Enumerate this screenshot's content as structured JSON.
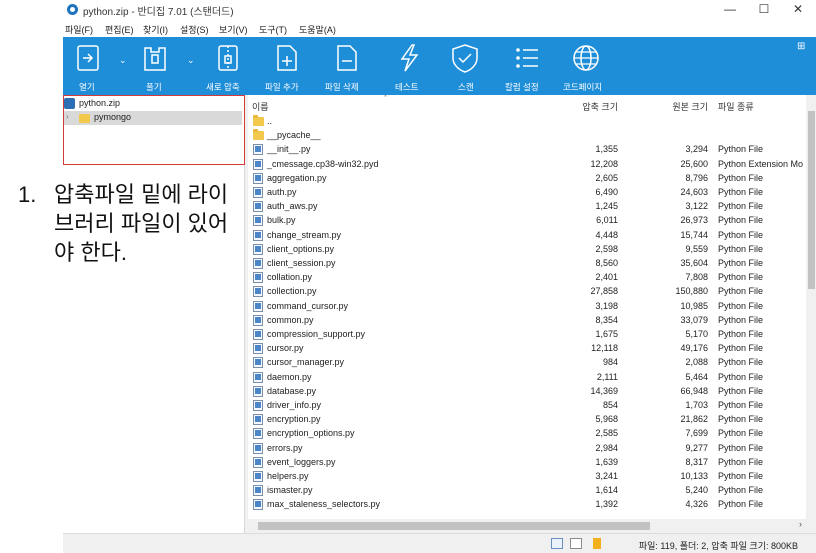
{
  "window": {
    "title": "python.zip - 반디집 7.01 (스탠더드)",
    "controls": [
      "—",
      "☐",
      "✕"
    ]
  },
  "menu": [
    "파일(F)",
    "편집(E)",
    "찾기(I)",
    "설정(S)",
    "보기(V)",
    "도구(T)",
    "도움말(A)"
  ],
  "toolbar": {
    "buttons": [
      {
        "label": "열기",
        "icon": "open-icon"
      },
      {
        "label": "풀기",
        "icon": "extract-icon"
      },
      {
        "label": "새로 압축",
        "icon": "new-archive-icon"
      },
      {
        "label": "파일 추가",
        "icon": "add-file-icon"
      },
      {
        "label": "파일 삭제",
        "icon": "delete-file-icon"
      },
      {
        "label": "테스트",
        "icon": "test-icon"
      },
      {
        "label": "스캔",
        "icon": "scan-shield-icon"
      },
      {
        "label": "칼럼 설정",
        "icon": "column-settings-icon"
      },
      {
        "label": "코드페이지",
        "icon": "codepage-globe-icon"
      }
    ],
    "layout_toggle": "⊞"
  },
  "tree": {
    "root": "python.zip",
    "child": "pymongo"
  },
  "list": {
    "headers": {
      "name": "이름",
      "compressed": "압축 크기",
      "original": "원본 크기",
      "type": "파일 종류"
    },
    "rows": [
      {
        "name": "..",
        "compressed": "",
        "original": "",
        "type": "",
        "kind": "folder"
      },
      {
        "name": "__pycache__",
        "compressed": "",
        "original": "",
        "type": "",
        "kind": "folder"
      },
      {
        "name": "__init__.py",
        "compressed": "1,355",
        "original": "3,294",
        "type": "Python File",
        "kind": "file"
      },
      {
        "name": "_cmessage.cp38-win32.pyd",
        "compressed": "12,208",
        "original": "25,600",
        "type": "Python Extension Mo",
        "kind": "file"
      },
      {
        "name": "aggregation.py",
        "compressed": "2,605",
        "original": "8,796",
        "type": "Python File",
        "kind": "file"
      },
      {
        "name": "auth.py",
        "compressed": "6,490",
        "original": "24,603",
        "type": "Python File",
        "kind": "file"
      },
      {
        "name": "auth_aws.py",
        "compressed": "1,245",
        "original": "3,122",
        "type": "Python File",
        "kind": "file"
      },
      {
        "name": "bulk.py",
        "compressed": "6,011",
        "original": "26,973",
        "type": "Python File",
        "kind": "file"
      },
      {
        "name": "change_stream.py",
        "compressed": "4,448",
        "original": "15,744",
        "type": "Python File",
        "kind": "file"
      },
      {
        "name": "client_options.py",
        "compressed": "2,598",
        "original": "9,559",
        "type": "Python File",
        "kind": "file"
      },
      {
        "name": "client_session.py",
        "compressed": "8,560",
        "original": "35,604",
        "type": "Python File",
        "kind": "file"
      },
      {
        "name": "collation.py",
        "compressed": "2,401",
        "original": "7,808",
        "type": "Python File",
        "kind": "file"
      },
      {
        "name": "collection.py",
        "compressed": "27,858",
        "original": "150,880",
        "type": "Python File",
        "kind": "file"
      },
      {
        "name": "command_cursor.py",
        "compressed": "3,198",
        "original": "10,985",
        "type": "Python File",
        "kind": "file"
      },
      {
        "name": "common.py",
        "compressed": "8,354",
        "original": "33,079",
        "type": "Python File",
        "kind": "file"
      },
      {
        "name": "compression_support.py",
        "compressed": "1,675",
        "original": "5,170",
        "type": "Python File",
        "kind": "file"
      },
      {
        "name": "cursor.py",
        "compressed": "12,118",
        "original": "49,176",
        "type": "Python File",
        "kind": "file"
      },
      {
        "name": "cursor_manager.py",
        "compressed": "984",
        "original": "2,088",
        "type": "Python File",
        "kind": "file"
      },
      {
        "name": "daemon.py",
        "compressed": "2,111",
        "original": "5,464",
        "type": "Python File",
        "kind": "file"
      },
      {
        "name": "database.py",
        "compressed": "14,369",
        "original": "66,948",
        "type": "Python File",
        "kind": "file"
      },
      {
        "name": "driver_info.py",
        "compressed": "854",
        "original": "1,703",
        "type": "Python File",
        "kind": "file"
      },
      {
        "name": "encryption.py",
        "compressed": "5,968",
        "original": "21,862",
        "type": "Python File",
        "kind": "file"
      },
      {
        "name": "encryption_options.py",
        "compressed": "2,585",
        "original": "7,699",
        "type": "Python File",
        "kind": "file"
      },
      {
        "name": "errors.py",
        "compressed": "2,984",
        "original": "9,277",
        "type": "Python File",
        "kind": "file"
      },
      {
        "name": "event_loggers.py",
        "compressed": "1,639",
        "original": "8,317",
        "type": "Python File",
        "kind": "file"
      },
      {
        "name": "helpers.py",
        "compressed": "3,241",
        "original": "10,133",
        "type": "Python File",
        "kind": "file"
      },
      {
        "name": "ismaster.py",
        "compressed": "1,614",
        "original": "5,240",
        "type": "Python File",
        "kind": "file"
      },
      {
        "name": "max_staleness_selectors.py",
        "compressed": "1,392",
        "original": "4,326",
        "type": "Python File",
        "kind": "file"
      }
    ]
  },
  "status": {
    "text": "파일: 119, 폴더: 2, 압축 파일 크기: 800KB"
  },
  "annotation": {
    "number": "1.",
    "text": "압축파일 밑에 라이브러리 파일이 있어야 한다."
  },
  "colors": {
    "toolbar": "#1f8ed8",
    "highlight_border": "#d23b3b"
  }
}
